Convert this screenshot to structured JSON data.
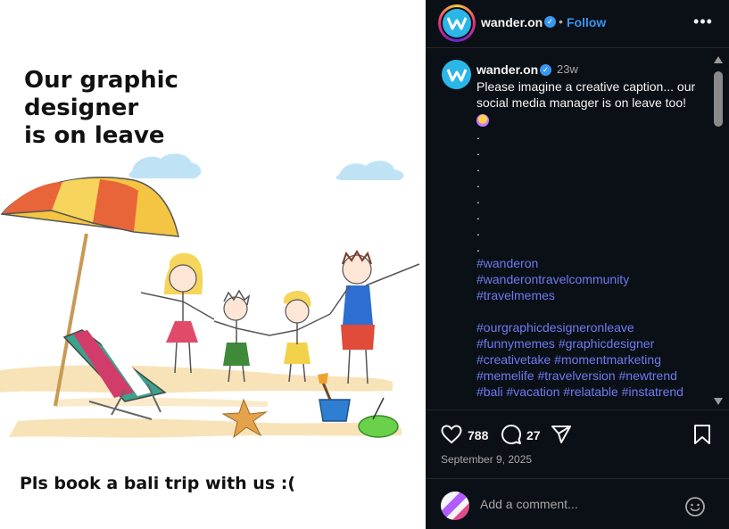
{
  "post_image": {
    "headline_line1": "Our graphic designer",
    "headline_line2": "is on leave",
    "footline": "Pls book a bali trip with us :("
  },
  "header": {
    "username": "wander.on",
    "separator": "•",
    "follow_label": "Follow",
    "verified_icon": "verified-badge-icon",
    "more_icon": "more-options-icon"
  },
  "caption": {
    "username": "wander.on",
    "time_ago": "23w",
    "text_line1": "Please imagine a creative caption... our",
    "text_line2": "social media manager is on leave too!",
    "dots": [
      ".",
      ".",
      ".",
      ".",
      ".",
      ".",
      ".",
      "."
    ],
    "hashtag_lines": [
      "#wanderon",
      "#wanderontravelcommunity",
      "#travelmemes",
      "",
      "#ourgraphicdesigneronleave",
      "#funnymemes #graphicdesigner",
      "#creativetake #momentmarketing",
      "#memelife #travelversion #newtrend",
      "#bali #vacation #relatable #instatrend"
    ]
  },
  "actions": {
    "likes": "788",
    "comments": "27",
    "date": "September 9, 2025"
  },
  "comment_box": {
    "placeholder": "Add a comment..."
  },
  "colors": {
    "panel_bg": "#0b0f16",
    "link_blue": "#3897f0",
    "hashtag": "#6c7cf0",
    "brand_teal": "#2bb6e8"
  }
}
